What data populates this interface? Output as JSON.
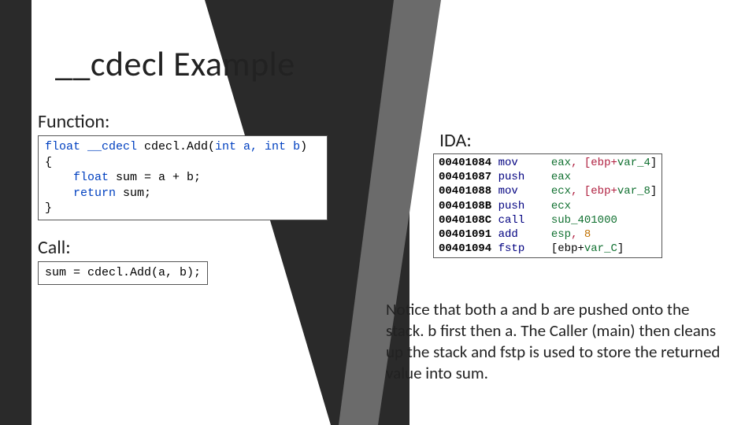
{
  "title": "__cdecl Example",
  "labels": {
    "function": "Function:",
    "call": "Call:",
    "ida": "IDA:"
  },
  "func_code": {
    "sig_pre": "float __cdecl ",
    "sig_name": "cdecl.Add(",
    "sig_args": "int a, int b",
    "sig_post": ")",
    "body1_pre": "    float ",
    "body1_mid": "sum = a + b;",
    "body2_pre": "    return ",
    "body2_mid": "sum;"
  },
  "call_code": {
    "pre": "sum = ",
    "fn": "cdecl.Add(a, b);"
  },
  "ida": [
    {
      "addr": "00401084",
      "mn": "mov",
      "args": [
        "eax",
        ", [ebp+",
        "var_4",
        "]"
      ]
    },
    {
      "addr": "00401087",
      "mn": "push",
      "args": [
        "eax"
      ]
    },
    {
      "addr": "00401088",
      "mn": "mov",
      "args": [
        "ecx",
        ", [ebp+",
        "var_8",
        "]"
      ]
    },
    {
      "addr": "0040108B",
      "mn": "push",
      "args": [
        "ecx"
      ]
    },
    {
      "addr": "0040108C",
      "mn": "call",
      "args": [
        "sub_401000"
      ]
    },
    {
      "addr": "00401091",
      "mn": "add",
      "args": [
        "esp",
        ", ",
        "8"
      ]
    },
    {
      "addr": "00401094",
      "mn": "fstp",
      "args": [
        "[ebp+",
        "var_C",
        "]"
      ]
    }
  ],
  "paragraph": "Notice that both a and b are pushed onto the stack.  b first then a.  The Caller (main) then cleans up the stack and fstp is used to store the returned value into sum."
}
